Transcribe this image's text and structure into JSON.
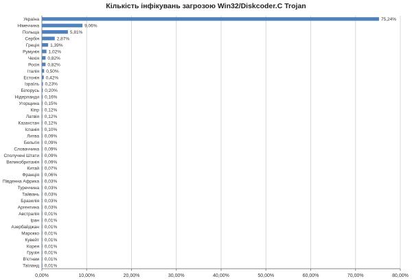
{
  "chart_data": {
    "type": "bar",
    "orientation": "horizontal",
    "title": "Кількість інфікувань загрозою Win32/Diskcoder.C Trojan",
    "xlabel": "",
    "ylabel": "",
    "xlim": [
      0,
      80
    ],
    "x_ticks": [
      "0,00%",
      "10,00%",
      "20,00%",
      "30,00%",
      "40,00%",
      "50,00%",
      "60,00%",
      "70,00%",
      "80,00%"
    ],
    "grid": true,
    "legend": "none",
    "bar_color": "#4f81bd",
    "categories": [
      "Україна",
      "Німеччина",
      "Польща",
      "Сербія",
      "Греція",
      "Румунія",
      "Чехія",
      "Росія",
      "Італія",
      "Естонія",
      "Ізраїль",
      "Білорусь",
      "Нідерланди",
      "Угорщина",
      "Кіпр",
      "Латвія",
      "Казахстан",
      "Іспанія",
      "Литва",
      "Бельгія",
      "Словаччина",
      "Сполучені Штати",
      "Великобританія",
      "Китай",
      "Франція",
      "Південна Африка",
      "Туреччина",
      "Тайвань",
      "Бразилія",
      "Аргентина",
      "Австралія",
      "Іран",
      "Азербайджан",
      "Марокко",
      "Кувейт",
      "Корея",
      "Грузія",
      "В'єтнам",
      "Таїланд"
    ],
    "values": [
      75.24,
      9.06,
      5.81,
      2.87,
      1.39,
      1.02,
      0.82,
      0.82,
      0.5,
      0.42,
      0.23,
      0.2,
      0.16,
      0.15,
      0.12,
      0.12,
      0.12,
      0.1,
      0.09,
      0.09,
      0.09,
      0.09,
      0.09,
      0.07,
      0.06,
      0.03,
      0.03,
      0.03,
      0.03,
      0.03,
      0.01,
      0.01,
      0.01,
      0.01,
      0.01,
      0.01,
      0.01,
      0.01,
      0.01
    ],
    "data_labels": [
      "75,24%",
      "9,06%",
      "5,81%",
      "2,87%",
      "1,39%",
      "1,02%",
      "0,82%",
      "0,82%",
      "0,50%",
      "0,42%",
      "0,23%",
      "0,20%",
      "0,16%",
      "0,15%",
      "0,12%",
      "0,12%",
      "0,12%",
      "0,10%",
      "0,09%",
      "0,09%",
      "0,09%",
      "0,09%",
      "0,09%",
      "0,07%",
      "0,06%",
      "0,03%",
      "0,03%",
      "0,03%",
      "0,03%",
      "0,03%",
      "0,01%",
      "0,01%",
      "0,01%",
      "0,01%",
      "0,01%",
      "0,01%",
      "0,01%",
      "0,01%",
      "0,01%"
    ]
  }
}
